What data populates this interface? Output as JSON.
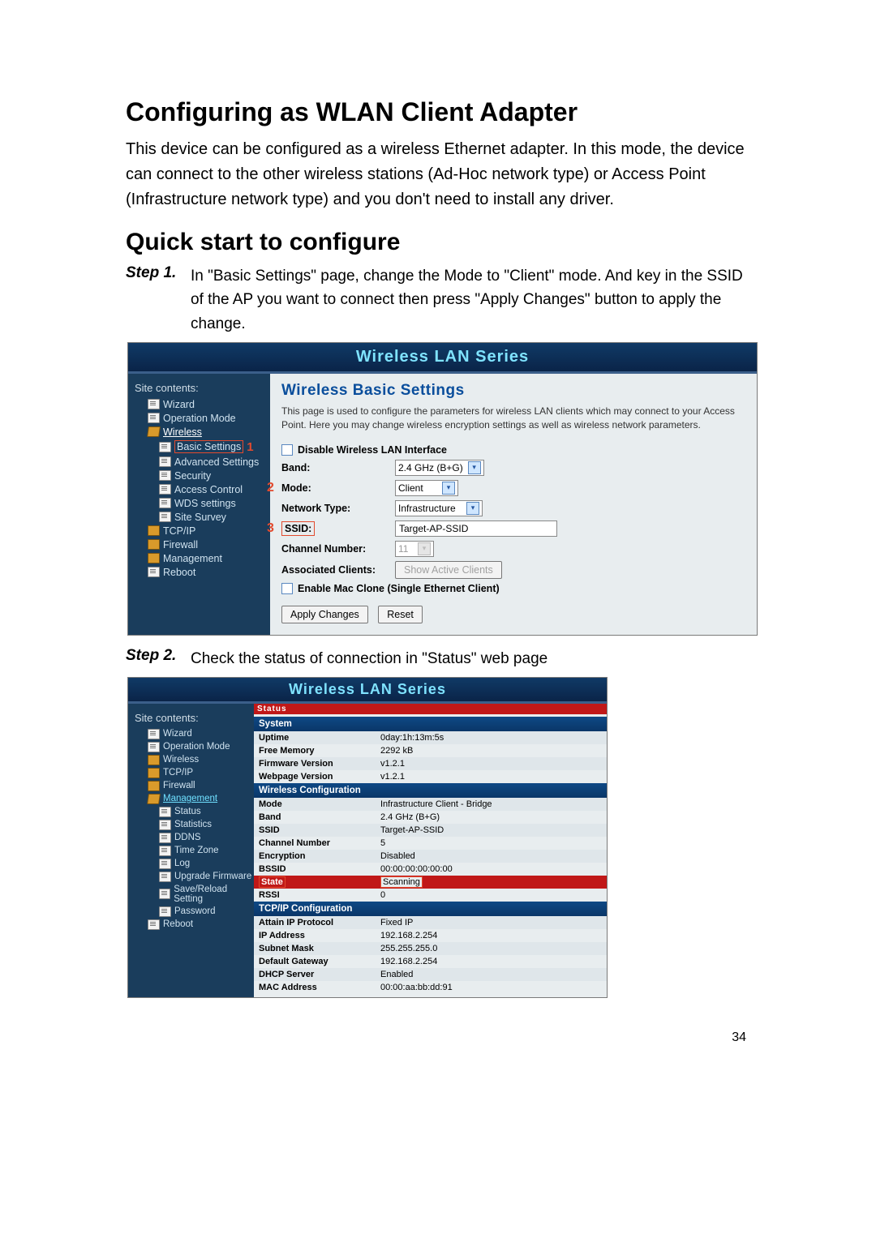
{
  "page_number": "34",
  "h1": "Configuring as WLAN Client Adapter",
  "intro": "This device can be configured as a wireless Ethernet adapter. In this mode, the device can connect to the other wireless stations (Ad-Hoc network type) or Access Point (Infrastructure network type) and you don't need to install any driver.",
  "h2": "Quick start to configure",
  "step1": {
    "label": "Step 1.",
    "text": "In \"Basic Settings\" page, change the Mode to \"Client\" mode. And key in the SSID of the AP you want to connect then press \"Apply Changes\" button to apply the change."
  },
  "step2": {
    "label": "Step 2.",
    "text": "Check the status of connection in \"Status\" web page"
  },
  "fig_title": "Wireless LAN Series",
  "sidebar_title": "Site contents:",
  "sidebar1": {
    "items": [
      {
        "label": "Wizard",
        "icon": "page",
        "level": 2
      },
      {
        "label": "Operation Mode",
        "icon": "page",
        "level": 2
      },
      {
        "label": "Wireless",
        "icon": "folder-open",
        "level": 2,
        "underline": true
      },
      {
        "label": "Basic Settings",
        "icon": "page",
        "level": 3,
        "boxed": true,
        "marker": "1"
      },
      {
        "label": "Advanced Settings",
        "icon": "page",
        "level": 3
      },
      {
        "label": "Security",
        "icon": "page",
        "level": 3
      },
      {
        "label": "Access Control",
        "icon": "page",
        "level": 3
      },
      {
        "label": "WDS settings",
        "icon": "page",
        "level": 3
      },
      {
        "label": "Site Survey",
        "icon": "page",
        "level": 3
      },
      {
        "label": "TCP/IP",
        "icon": "folder",
        "level": 2
      },
      {
        "label": "Firewall",
        "icon": "folder",
        "level": 2
      },
      {
        "label": "Management",
        "icon": "folder",
        "level": 2
      },
      {
        "label": "Reboot",
        "icon": "page",
        "level": 2
      }
    ]
  },
  "basic": {
    "heading": "Wireless Basic Settings",
    "desc": "This page is used to configure the parameters for wireless LAN clients which may connect to your Access Point. Here you may change wireless encryption settings as well as wireless network parameters.",
    "disable_label": "Disable Wireless LAN Interface",
    "band_label": "Band:",
    "band_value": "2.4 GHz (B+G)",
    "mode_label": "Mode:",
    "mode_value": "Client",
    "mode_marker": "2",
    "nettype_label": "Network Type:",
    "nettype_value": "Infrastructure",
    "ssid_label": "SSID:",
    "ssid_value": "Target-AP-SSID",
    "ssid_marker": "3",
    "chan_label": "Channel Number:",
    "chan_value": "11",
    "assoc_label": "Associated Clients:",
    "assoc_btn": "Show Active Clients",
    "maclone_label": "Enable Mac Clone (Single Ethernet Client)",
    "apply_btn": "Apply Changes",
    "reset_btn": "Reset"
  },
  "sidebar2": {
    "items": [
      {
        "label": "Wizard",
        "icon": "page",
        "level": 2
      },
      {
        "label": "Operation Mode",
        "icon": "page",
        "level": 2
      },
      {
        "label": "Wireless",
        "icon": "folder",
        "level": 2
      },
      {
        "label": "TCP/IP",
        "icon": "folder",
        "level": 2
      },
      {
        "label": "Firewall",
        "icon": "folder",
        "level": 2
      },
      {
        "label": "Management",
        "icon": "folder-open",
        "level": 2,
        "mgmt": true
      },
      {
        "label": "Status",
        "icon": "page",
        "level": 3
      },
      {
        "label": "Statistics",
        "icon": "page",
        "level": 3
      },
      {
        "label": "DDNS",
        "icon": "page",
        "level": 3
      },
      {
        "label": "Time Zone",
        "icon": "page",
        "level": 3
      },
      {
        "label": "Log",
        "icon": "page",
        "level": 3
      },
      {
        "label": "Upgrade Firmware",
        "icon": "page",
        "level": 3
      },
      {
        "label": "Save/Reload Setting",
        "icon": "page",
        "level": 3
      },
      {
        "label": "Password",
        "icon": "page",
        "level": 3
      },
      {
        "label": "Reboot",
        "icon": "page",
        "level": 2
      }
    ]
  },
  "status": {
    "top_word": "Status",
    "sections": [
      {
        "header": "System",
        "rows": [
          {
            "k": "Uptime",
            "v": "0day:1h:13m:5s"
          },
          {
            "k": "Free Memory",
            "v": "2292 kB"
          },
          {
            "k": "Firmware Version",
            "v": "v1.2.1"
          },
          {
            "k": "Webpage Version",
            "v": "v1.2.1"
          }
        ]
      },
      {
        "header": "Wireless Configuration",
        "rows": [
          {
            "k": "Mode",
            "v": "Infrastructure Client - Bridge"
          },
          {
            "k": "Band",
            "v": "2.4 GHz (B+G)"
          },
          {
            "k": "SSID",
            "v": "Target-AP-SSID"
          },
          {
            "k": "Channel Number",
            "v": "5"
          },
          {
            "k": "Encryption",
            "v": "Disabled"
          },
          {
            "k": "BSSID",
            "v": "00:00:00:00:00:00"
          }
        ]
      },
      {
        "header": "State",
        "state": true,
        "rows": [
          {
            "k": "State",
            "v": "Scanning",
            "boxed": true,
            "stateRow": true
          },
          {
            "k": "RSSI",
            "v": "0"
          }
        ]
      },
      {
        "header": "TCP/IP Configuration",
        "rows": [
          {
            "k": "Attain IP Protocol",
            "v": "Fixed IP"
          },
          {
            "k": "IP Address",
            "v": "192.168.2.254"
          },
          {
            "k": "Subnet Mask",
            "v": "255.255.255.0"
          },
          {
            "k": "Default Gateway",
            "v": "192.168.2.254"
          },
          {
            "k": "DHCP Server",
            "v": "Enabled"
          },
          {
            "k": "MAC Address",
            "v": "00:00:aa:bb:dd:91"
          }
        ]
      }
    ]
  }
}
